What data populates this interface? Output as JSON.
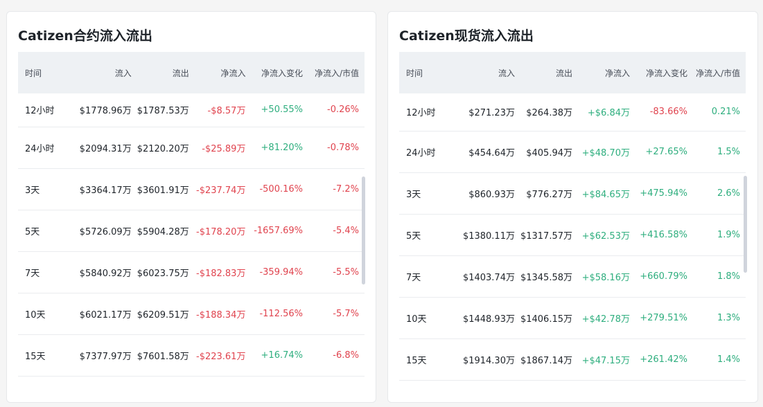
{
  "colors": {
    "positive": "#2eae7e",
    "negative": "#e0434e",
    "header_bg": "#eef1f4"
  },
  "left": {
    "title": "Catizen合约流入流出",
    "headers": [
      "时间",
      "流入",
      "流出",
      "净流入",
      "净流入变化",
      "净流入/市值"
    ],
    "rows": [
      [
        "12小时",
        "$1778.96万",
        "$1787.53万",
        "-$8.57万",
        "+50.55%",
        "-0.26%"
      ],
      [
        "24小时",
        "$2094.31万",
        "$2120.20万",
        "-$25.89万",
        "+81.20%",
        "-0.78%"
      ],
      [
        "3天",
        "$3364.17万",
        "$3601.91万",
        "-$237.74万",
        "-500.16%",
        "-7.2%"
      ],
      [
        "5天",
        "$5726.09万",
        "$5904.28万",
        "-$178.20万",
        "-1657.69%",
        "-5.4%"
      ],
      [
        "7天",
        "$5840.92万",
        "$6023.75万",
        "-$182.83万",
        "-359.94%",
        "-5.5%"
      ],
      [
        "10天",
        "$6021.17万",
        "$6209.51万",
        "-$188.34万",
        "-112.56%",
        "-5.7%"
      ],
      [
        "15天",
        "$7377.97万",
        "$7601.58万",
        "-$223.61万",
        "+16.74%",
        "-6.8%"
      ]
    ]
  },
  "right": {
    "title": "Catizen现货流入流出",
    "headers": [
      "时间",
      "流入",
      "流出",
      "净流入",
      "净流入变化",
      "净流入/市值"
    ],
    "rows": [
      [
        "12小时",
        "$271.23万",
        "$264.38万",
        "+$6.84万",
        "-83.66%",
        "0.21%"
      ],
      [
        "24小时",
        "$454.64万",
        "$405.94万",
        "+$48.70万",
        "+27.65%",
        "1.5%"
      ],
      [
        "3天",
        "$860.93万",
        "$776.27万",
        "+$84.65万",
        "+475.94%",
        "2.6%"
      ],
      [
        "5天",
        "$1380.11万",
        "$1317.57万",
        "+$62.53万",
        "+416.58%",
        "1.9%"
      ],
      [
        "7天",
        "$1403.74万",
        "$1345.58万",
        "+$58.16万",
        "+660.79%",
        "1.8%"
      ],
      [
        "10天",
        "$1448.93万",
        "$1406.15万",
        "+$42.78万",
        "+279.51%",
        "1.3%"
      ],
      [
        "15天",
        "$1914.30万",
        "$1867.14万",
        "+$47.15万",
        "+261.42%",
        "1.4%"
      ]
    ]
  }
}
